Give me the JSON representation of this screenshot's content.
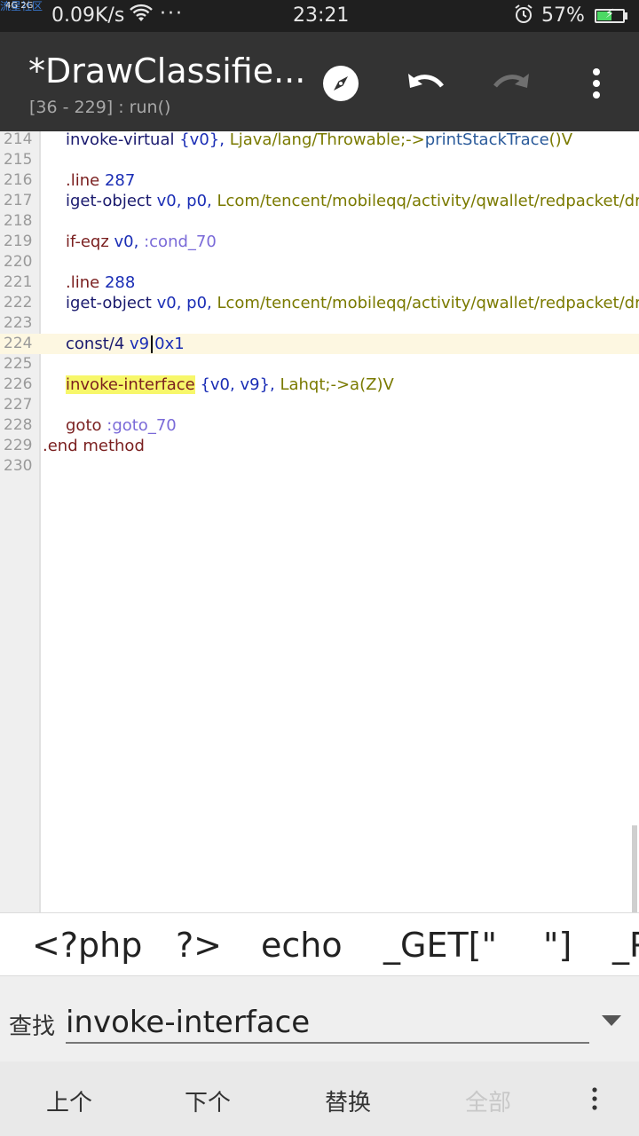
{
  "status_bar": {
    "watermark": "流星社区",
    "network": "4G 2G",
    "speed": "0.09K/s",
    "dots": "···",
    "time": "23:21",
    "battery": "57%",
    "battery_level": 0.57
  },
  "app_bar": {
    "title": "*DrawClassifie...",
    "subtitle": "[36 - 229] : run()",
    "icons": [
      "compass-icon",
      "undo-icon",
      "redo-icon",
      "more-icon"
    ]
  },
  "editor": {
    "lines": [
      {
        "num": "214"
      },
      {
        "num": "215"
      },
      {
        "num": "216"
      },
      {
        "num": "217"
      },
      {
        "num": "218"
      },
      {
        "num": "219"
      },
      {
        "num": "220"
      },
      {
        "num": "221"
      },
      {
        "num": "222"
      },
      {
        "num": "223"
      },
      {
        "num": "224"
      },
      {
        "num": "225"
      },
      {
        "num": "226"
      },
      {
        "num": "227"
      },
      {
        "num": "228"
      },
      {
        "num": "229"
      },
      {
        "num": "230"
      }
    ],
    "code": {
      "l214": {
        "op": "invoke-virtual",
        "regs": "{v0},",
        "type": "Ljava/lang/Throwable;->",
        "m": "printStackTrace",
        "tail": "()V"
      },
      "l216": {
        "op": ".line",
        "val": "287"
      },
      "l217": {
        "op": "iget-object",
        "regs": "v0, p0,",
        "type": "Lcom/tencent/mobileqq/activity/qwallet/redpacket/draw/D"
      },
      "l219": {
        "op": "if-eqz",
        "regs": "v0,",
        "label": ":cond_70"
      },
      "l221": {
        "op": ".line",
        "val": "288"
      },
      "l222": {
        "op": "iget-object",
        "regs": "v0, p0,",
        "type": "Lcom/tencent/mobileqq/activity/qwallet/redpacket/draw/D"
      },
      "l224": {
        "op": "const/4",
        "reg1": "v9",
        "val": "0x1"
      },
      "l226": {
        "op": "invoke-interface",
        "regs": "{v0, v9},",
        "type": "Lahqt;->a(Z)V"
      },
      "l228": {
        "op": "goto",
        "label": ":goto_70"
      },
      "l229": {
        "op": ".end method"
      }
    }
  },
  "symbol_bar": [
    "<?php",
    "?>",
    "echo",
    "_GET[\"",
    "\"]",
    "_P"
  ],
  "find_bar": {
    "label": "查找",
    "value": "invoke-interface"
  },
  "actions": {
    "prev": "上个",
    "next": "下个",
    "replace": "替换",
    "all": "全部"
  }
}
